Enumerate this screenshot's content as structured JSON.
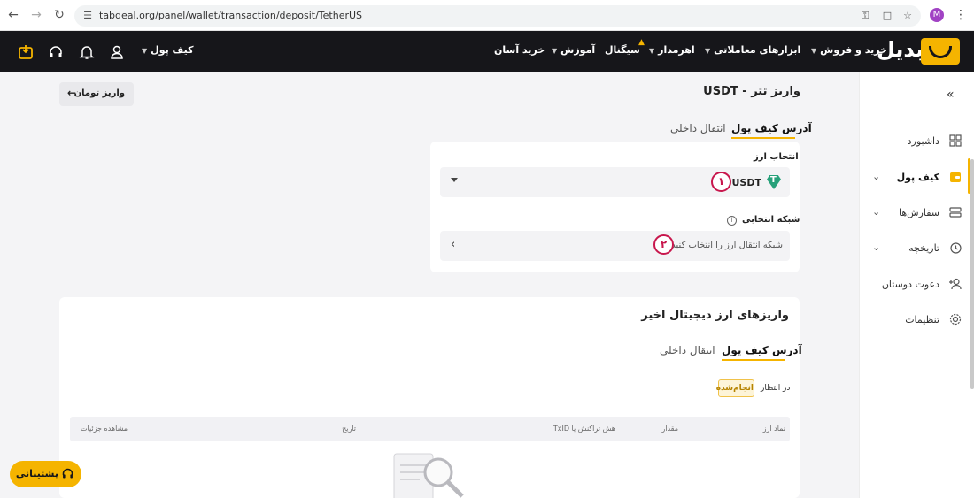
{
  "browser": {
    "url": "tabdeal.org/panel/wallet/transaction/deposit/TetherUS",
    "profile_initial": "M"
  },
  "header": {
    "logo_text": "تبدیل",
    "nav": [
      {
        "label": "خرید و فروش",
        "dropdown": true
      },
      {
        "label": "ابزارهای معاملاتی",
        "dropdown": true
      },
      {
        "label": "اهرمدار",
        "dropdown": true
      },
      {
        "label": "سیگنال",
        "dropdown": false
      },
      {
        "label": "آموزش",
        "dropdown": true
      },
      {
        "label": "خرید آسان",
        "dropdown": false
      }
    ],
    "wallet_label": "کیف پول",
    "brand_color": "#f5b400"
  },
  "sidebar": {
    "items": [
      {
        "label": "داشبورد",
        "icon": "grid-icon"
      },
      {
        "label": "کیف پول",
        "icon": "wallet-icon"
      },
      {
        "label": "سفارش‌ها",
        "icon": "orders-icon"
      },
      {
        "label": "تاریخچه",
        "icon": "history-icon"
      },
      {
        "label": "دعوت دوستان",
        "icon": "add-user-icon"
      },
      {
        "label": "تنظیمات",
        "icon": "gear-icon"
      }
    ]
  },
  "main": {
    "title": "واریز تتر - USDT",
    "toman_button": "واریز تومان",
    "tabs": [
      "آدرس کیف پول",
      "انتقال داخلی"
    ],
    "currency_label": "انتخاب ارز",
    "currency_value": "USDT",
    "network_label": "شبکه انتخابی",
    "network_placeholder": "شبکه انتقال ارز را انتخاب کنید",
    "badge_1": "۱",
    "badge_2": "۲"
  },
  "recent": {
    "title": "واریزهای ارز دیجیتال اخیر",
    "tabs": [
      "آدرس کیف پول",
      "انتقال داخلی"
    ],
    "filter_pending": "در انتظار",
    "filter_done": "انجام‌شده",
    "columns": [
      "نماد ارز",
      "مقدار",
      "هش تراکنش یا TxID",
      "تاریخ",
      "مشاهده جزئیات"
    ]
  },
  "support": {
    "label": "پشتیبانی"
  }
}
